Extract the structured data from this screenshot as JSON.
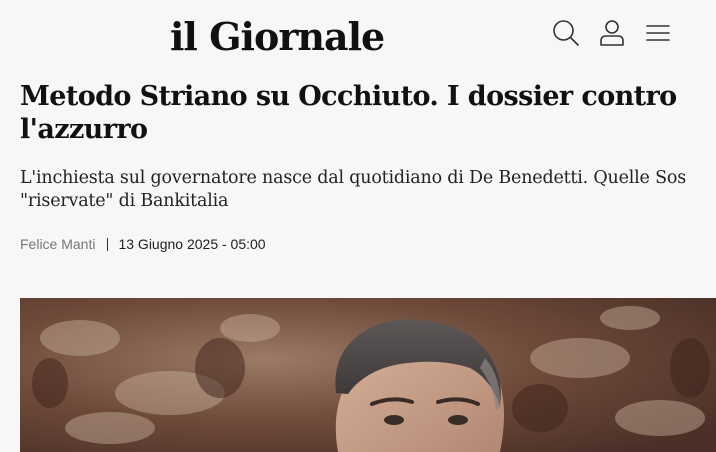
{
  "header": {
    "logo": "il Giornale",
    "icons": [
      "search-icon",
      "user-icon",
      "menu-icon"
    ]
  },
  "article": {
    "title": "Metodo Striano su Occhiuto. I dossier contro l'azzurro",
    "subtitle": "L'inchiesta sul governatore nasce dal quotidiano di De Benedetti. Quelle Sos \"riservate\" di Bankitalia",
    "author": "Felice Manti",
    "date": "13 Giugno 2025 - 05:00"
  },
  "colors": {
    "background": "#f7f7f7",
    "text": "#111111",
    "author": "#777777"
  }
}
